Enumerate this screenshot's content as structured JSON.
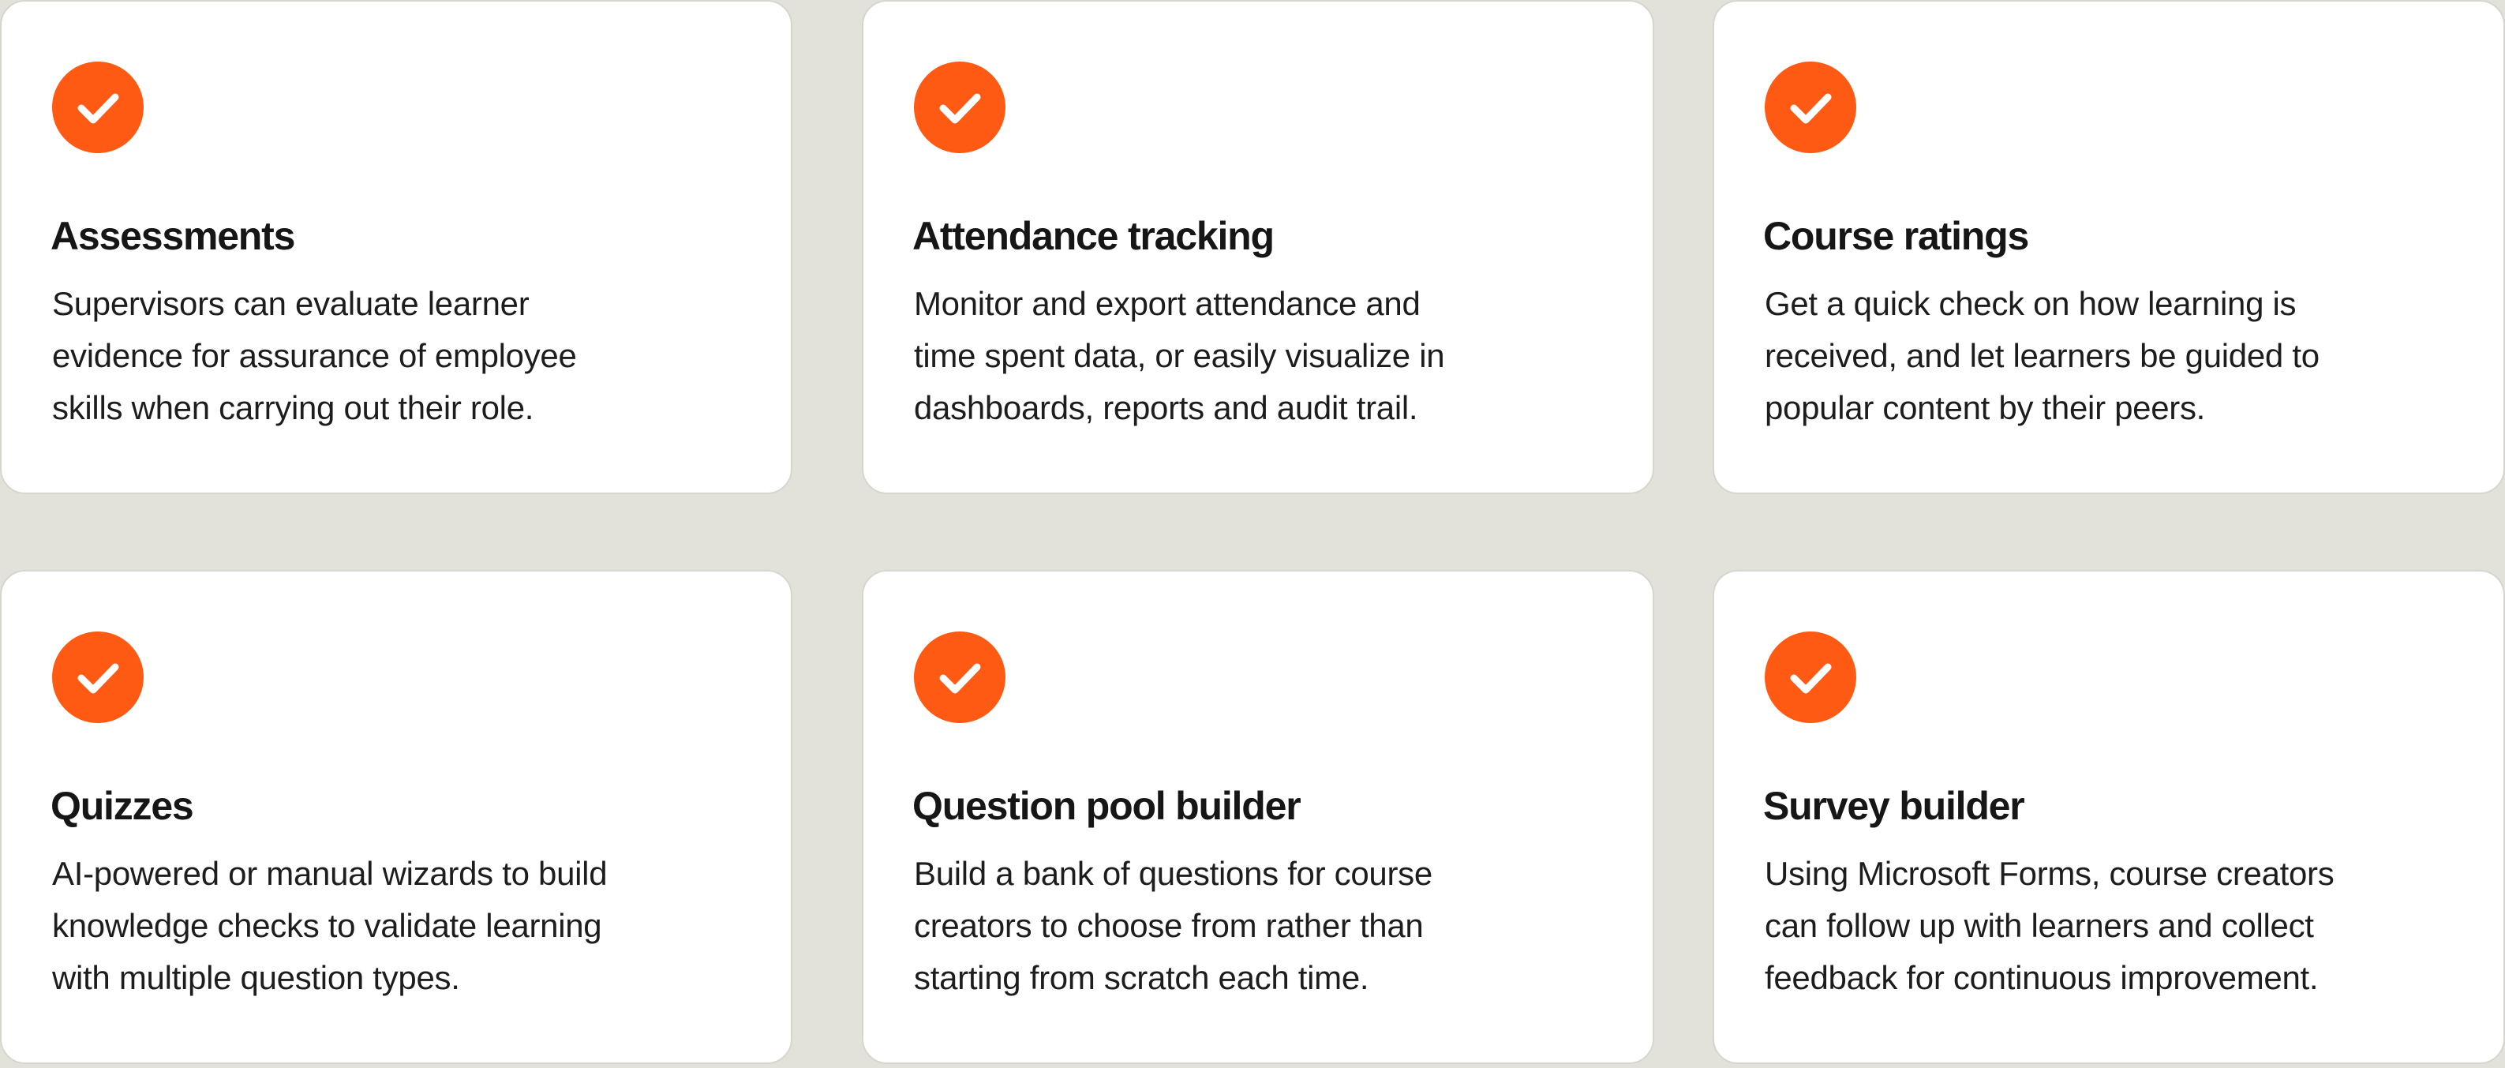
{
  "colors": {
    "background": "#e2e1da",
    "card": "#ffffff",
    "accent": "#ff5a14",
    "text": "#161616"
  },
  "cards": [
    {
      "icon": "checkmark-icon",
      "title": "Assessments",
      "description": "Supervisors can evaluate learner\nevidence for assurance of employee\nskills when carrying out their role."
    },
    {
      "icon": "checkmark-icon",
      "title": "Attendance tracking",
      "description": "Monitor and export attendance and\ntime spent data, or easily visualize in\ndashboards, reports and audit trail."
    },
    {
      "icon": "checkmark-icon",
      "title": "Course ratings",
      "description": "Get a quick check on how learning  is\nreceived, and let learners be guided to\npopular content by their peers."
    },
    {
      "icon": "checkmark-icon",
      "title": "Quizzes",
      "description": "AI-powered or manual wizards to build\nknowledge checks to validate learning\nwith multiple question types."
    },
    {
      "icon": "checkmark-icon",
      "title": "Question pool builder",
      "description": "Build a bank of questions  for course\ncreators to choose from rather than\nstarting from scratch each time."
    },
    {
      "icon": "checkmark-icon",
      "title": "Survey builder",
      "description": "Using Microsoft Forms, course creators\ncan follow up with learners and collect\nfeedback for continuous improvement."
    }
  ]
}
